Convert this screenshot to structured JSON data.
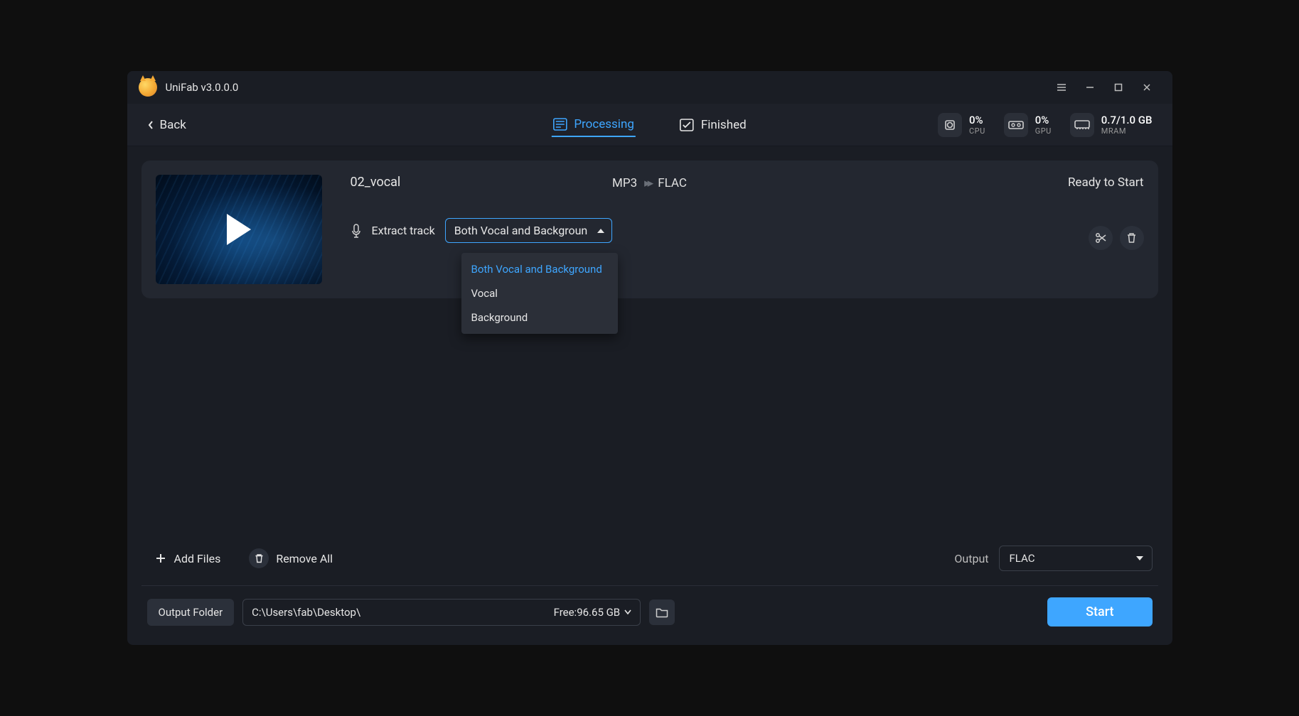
{
  "window": {
    "title": "UniFab v3.0.0.0"
  },
  "header": {
    "back": "Back",
    "tabs": {
      "processing": "Processing",
      "finished": "Finished"
    },
    "stats": {
      "cpu": {
        "value": "0%",
        "label": "CPU"
      },
      "gpu": {
        "value": "0%",
        "label": "GPU"
      },
      "mram": {
        "value": "0.7/1.0 GB",
        "label": "MRAM"
      }
    }
  },
  "job": {
    "filename": "02_vocal",
    "src_format": "MP3",
    "dst_format": "FLAC",
    "status": "Ready to Start",
    "extract_label": "Extract track",
    "extract_value": "Both Vocal and Backgroun",
    "extract_options": [
      "Both Vocal and Background",
      "Vocal",
      "Background"
    ]
  },
  "tools": {
    "add_files": "Add Files",
    "remove_all": "Remove All",
    "output_label": "Output",
    "output_value": "FLAC"
  },
  "footer": {
    "folder_btn": "Output Folder",
    "path": "C:\\Users\\fab\\Desktop\\",
    "free": "Free:96.65 GB",
    "start": "Start"
  }
}
